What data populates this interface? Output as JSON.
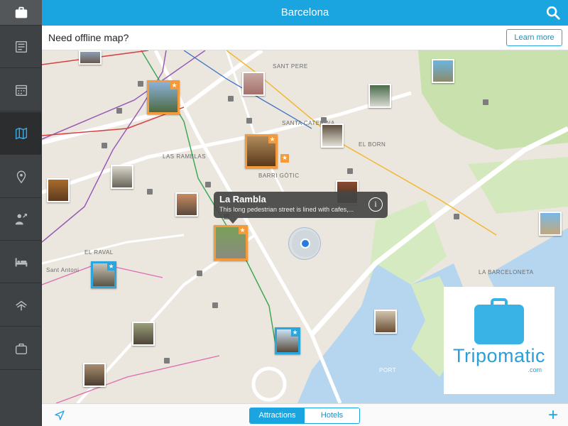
{
  "header": {
    "title": "Barcelona",
    "search_icon": "search-icon"
  },
  "banner": {
    "text": "Need offline map?",
    "learn_more": "Learn more"
  },
  "sidebar": {
    "items": [
      {
        "name": "suitcase",
        "icon": "suitcase-icon"
      },
      {
        "name": "guide",
        "icon": "newspaper-icon"
      },
      {
        "name": "calendar",
        "icon": "calendar-icon"
      },
      {
        "name": "map",
        "icon": "map-icon",
        "active": true
      },
      {
        "name": "places",
        "icon": "pin-icon"
      },
      {
        "name": "activities",
        "icon": "person-icon"
      },
      {
        "name": "hotels",
        "icon": "bed-icon"
      },
      {
        "name": "transport",
        "icon": "transport-icon"
      },
      {
        "name": "luggage",
        "icon": "luggage-icon"
      }
    ]
  },
  "map": {
    "districts": [
      "SANT PERE",
      "SANTA CATERINA",
      "LAS RAMBLAS",
      "BARRI GÒTIC",
      "EL BORN",
      "EL RAVAL",
      "LA BARCELONETA",
      "Sant Antoni",
      "PORT"
    ],
    "callout": {
      "title": "La Rambla",
      "description": "This long pedestrian street is lined with cafes,..."
    }
  },
  "logo": {
    "text": "Tripomatic",
    "suffix": ".com"
  },
  "bottom": {
    "tabs": [
      "Attractions",
      "Hotels"
    ],
    "active_tab": "Attractions",
    "plus": "+"
  },
  "colors": {
    "accent": "#1aa4e0",
    "sidebar": "#3f4244",
    "orange": "#f39a3c",
    "water": "#b3d4ef",
    "park": "#bfdca0"
  }
}
